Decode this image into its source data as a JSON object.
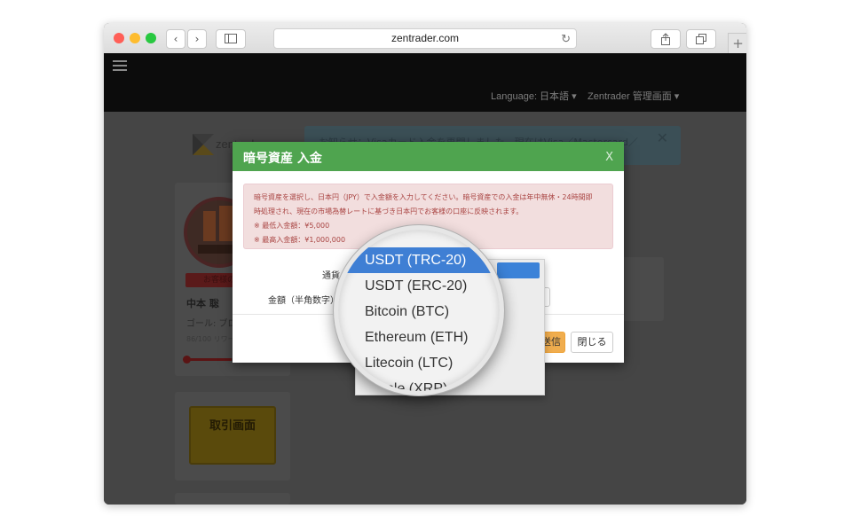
{
  "browser": {
    "url": "zentrader.com",
    "reload_icon": "↻",
    "back_icon": "‹",
    "forward_icon": "›",
    "new_tab_icon": "+"
  },
  "navbar": {
    "language_label": "Language: 日本語",
    "admin_label": "Zentrader 管理画面"
  },
  "page": {
    "logo_text": "zentrader",
    "notice": "お知らせ：Visaカード入金を再開しました。現在はVisa／Mastercard／",
    "notice_close": "✕",
    "user": {
      "badge": "お客様の",
      "name": "中本 聡",
      "goal": "ゴール: ブロ",
      "points": "86/100 リワー",
      "progress": 0.86
    },
    "trade_button": "取引画面"
  },
  "modal": {
    "title": "暗号資産 入金",
    "close_x": "X",
    "alert_lines": [
      "暗号資産を選択し、日本円（JPY）で入金額を入力してください。暗号資産での入金は年中無休・24時間即",
      "時処理され、現在の市場為替レートに基づき日本円でお客様の口座に反映されます。",
      "※ 最低入金額：¥5,000",
      "※ 最高入金額：¥1,000,000"
    ],
    "currency_label": "通貨",
    "amount_label": "金額（半角数字）",
    "submit_label": "送信",
    "close_label": "閉じる"
  },
  "dropdown": {
    "selected": "USDT (TRC-20)",
    "options": [
      "USDT (TRC-20)",
      "USDT (ERC-20)",
      "Bitcoin (BTC)",
      "Ethereum (ETH)",
      "Litecoin (LTC)",
      "Ripple (XRP)"
    ]
  }
}
